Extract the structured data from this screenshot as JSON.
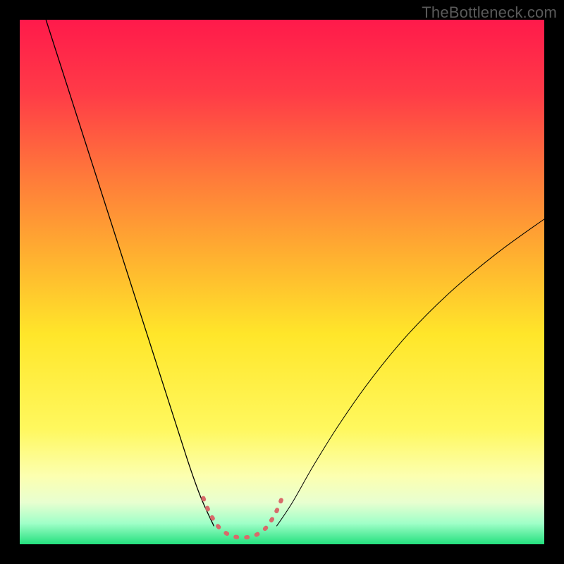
{
  "watermark": "TheBottleneck.com",
  "chart_data": {
    "type": "line",
    "title": "",
    "xlabel": "",
    "ylabel": "",
    "xlim": [
      0,
      100
    ],
    "ylim": [
      0,
      100
    ],
    "background_gradient": {
      "stops": [
        {
          "offset": 0.0,
          "color": "#ff1a4b"
        },
        {
          "offset": 0.14,
          "color": "#ff3b47"
        },
        {
          "offset": 0.3,
          "color": "#ff7a3a"
        },
        {
          "offset": 0.45,
          "color": "#ffb030"
        },
        {
          "offset": 0.6,
          "color": "#ffe62a"
        },
        {
          "offset": 0.78,
          "color": "#fff85e"
        },
        {
          "offset": 0.87,
          "color": "#fcffb0"
        },
        {
          "offset": 0.92,
          "color": "#e8ffd0"
        },
        {
          "offset": 0.96,
          "color": "#a0ffc8"
        },
        {
          "offset": 1.0,
          "color": "#24e07e"
        }
      ]
    },
    "series": [
      {
        "name": "left-arm",
        "color": "#000000",
        "width": 1.3,
        "x": [
          5,
          9.5,
          14,
          18.5,
          23,
          27.5,
          32,
          34.5,
          37
        ],
        "y": [
          100,
          86,
          72,
          58,
          44,
          30,
          16,
          9,
          3.5
        ]
      },
      {
        "name": "right-arm",
        "color": "#000000",
        "width": 1.0,
        "x": [
          49,
          52,
          56,
          61,
          67,
          74,
          82,
          91,
          100
        ],
        "y": [
          3.5,
          8,
          15,
          23,
          31.5,
          40,
          48,
          55.5,
          62
        ]
      },
      {
        "name": "valley-highlight",
        "color": "#d86a6a",
        "width": 6.0,
        "dashed": true,
        "x": [
          35.0,
          36.0,
          37.0,
          38.0,
          39.2,
          40.7,
          42.5,
          44.3,
          45.8,
          47.0,
          48.0,
          49.0,
          50.0
        ],
        "y": [
          8.8,
          6.4,
          4.6,
          3.2,
          2.2,
          1.5,
          1.3,
          1.5,
          2.2,
          3.2,
          4.6,
          6.4,
          8.8
        ]
      }
    ]
  }
}
